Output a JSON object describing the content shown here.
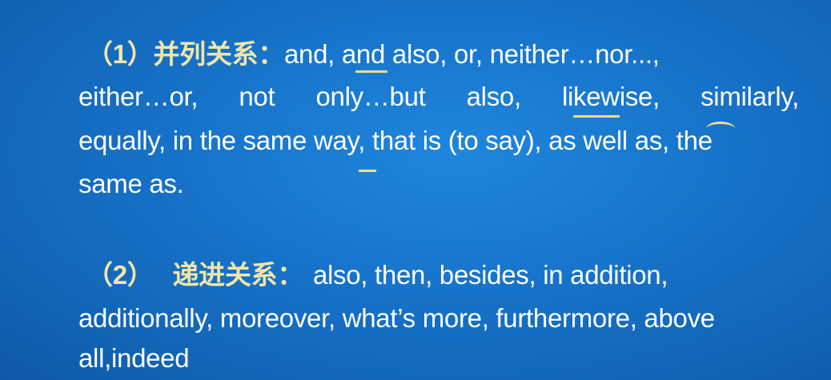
{
  "section1": {
    "number": "（1）",
    "title": "并列关系：",
    "first_line_text": "and, and also, or, neither…nor...,",
    "lines": [
      "either…or,",
      "not",
      "only…but",
      "also,",
      "likewise,",
      "similarly,"
    ],
    "line3": "equally, in the same way, that is (to say), as well as, the",
    "line4": "same as."
  },
  "section2": {
    "number": "（2）",
    "title": "递进关系：",
    "first_line_text": "also, then, besides, in addition,",
    "line2": "additionally, moreover, what’s more, furthermore, above",
    "line3": "all,indeed"
  }
}
